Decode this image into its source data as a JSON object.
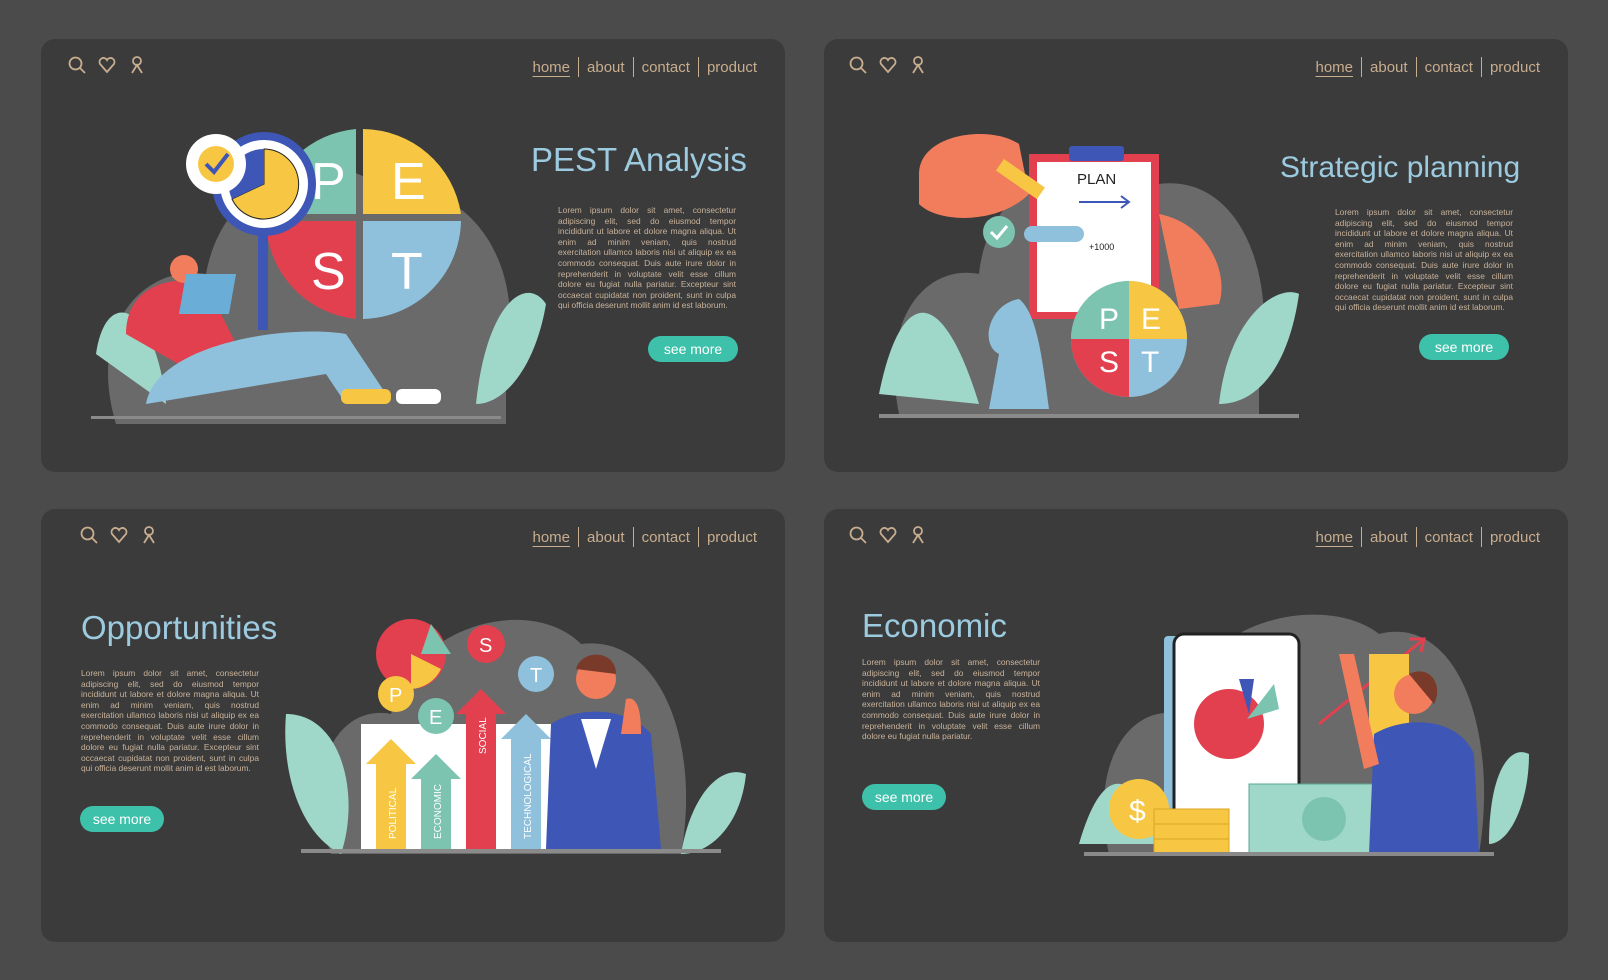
{
  "nav": {
    "home": "home",
    "about": "about",
    "contact": "contact",
    "product": "product"
  },
  "icons": [
    "search-icon",
    "heart-icon",
    "user-icon"
  ],
  "colors": {
    "background": "#4b4b4b",
    "card": "#3b3b3b",
    "title": "#9ccbe0",
    "text": "#c9b39a",
    "button": "#3ec1aa",
    "nav": "#c8ad8f",
    "red": "#e2404f",
    "yellow": "#f7c744",
    "teal": "#7cc4b0",
    "blue": "#8fc1dd",
    "indigo": "#3e56b6"
  },
  "cards": [
    {
      "title": "PEST Analysis",
      "button": "see more",
      "body": "Lorem ipsum dolor sit amet, consectetur adipiscing elit, sed do eiusmod tempor incididunt ut labore et dolore magna aliqua. Ut enim ad minim veniam, quis nostrud exercitation ullamco laboris nisi ut aliquip ex ea commodo consequat. Duis aute irure dolor in reprehenderit in voluptate velit esse cillum dolore eu fugiat nulla pariatur. Excepteur sint occaecat cupidatat non proident, sunt in culpa qui officia deserunt mollit anim id est laborum.",
      "letters": [
        "P",
        "E",
        "S",
        "T"
      ]
    },
    {
      "title": "Strategic planning",
      "button": "see more",
      "body": "Lorem ipsum dolor sit amet, consectetur adipiscing elit, sed do eiusmod tempor incididunt ut labore et dolore magna aliqua. Ut enim ad minim veniam, quis nostrud exercitation ullamco laboris nisi ut aliquip ex ea commodo consequat. Duis aute irure dolor in reprehenderit in voluptate velit esse cillum dolore eu fugiat nulla pariatur. Excepteur sint occaecat cupidatat non proident, sunt in culpa qui officia deserunt mollit anim id est laborum.",
      "plan": "PLAN",
      "plus": "+1000",
      "letters": [
        "P",
        "E",
        "S",
        "T"
      ]
    },
    {
      "title": "Opportunities",
      "button": "see more",
      "body": "Lorem ipsum dolor sit amet, consectetur adipiscing elit, sed do eiusmod tempor incididunt ut labore et dolore magna aliqua. Ut enim ad minim veniam, quis nostrud exercitation ullamco laboris nisi ut aliquip ex ea commodo consequat. Duis aute irure dolor in reprehenderit in voluptate velit esse cillum dolore eu fugiat nulla pariatur. Excepteur sint occaecat cupidatat non proident, sunt in culpa qui officia deserunt mollit anim id est laborum.",
      "letters": [
        "P",
        "E",
        "S",
        "T"
      ],
      "arrows": [
        "POLITICAL",
        "ECONOMIC",
        "SOCIAL",
        "TECHNOLOGICAL"
      ]
    },
    {
      "title": "Economic",
      "button": "see more",
      "body": "Lorem ipsum dolor sit amet, consectetur adipiscing elit, sed do eiusmod tempor incididunt ut labore et dolore magna aliqua. Ut enim ad minim veniam, quis nostrud exercitation ullamco laboris nisi ut aliquip ex ea commodo consequat. Duis aute irure dolor in reprehenderit in voluptate velit esse cillum dolore eu fugiat nulla pariatur.",
      "coin": "$"
    }
  ]
}
